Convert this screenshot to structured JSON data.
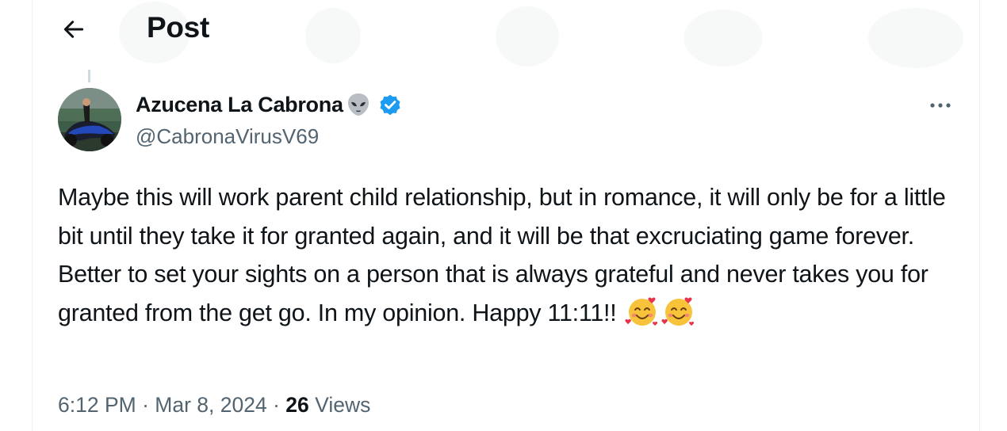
{
  "header": {
    "title": "Post"
  },
  "tweet": {
    "author_name": "Azucena La Cabrona",
    "handle": "@CabronaVirusV69",
    "text": "Maybe this will work parent child relationship, but in romance, it will only be for a little bit until they take it for granted again, and it will be that excruciating game forever. Better to set your sights on a person that is always grateful and never takes you for granted from the get go. In my opinion. Happy 11:11!!",
    "time": "6:12 PM",
    "date": "Mar 8, 2024",
    "views_count": "26",
    "views_label": "Views",
    "separator": "·"
  },
  "icons": {
    "back": "arrow-left-icon",
    "alien": "alien-emoji-icon",
    "verified": "verified-badge-icon",
    "more": "more-horizontal-icon",
    "emoji": "smiling-face-with-hearts-emoji"
  },
  "colors": {
    "verified": "#1d9bf0",
    "muted_text": "#536471",
    "text": "#0f1419"
  }
}
